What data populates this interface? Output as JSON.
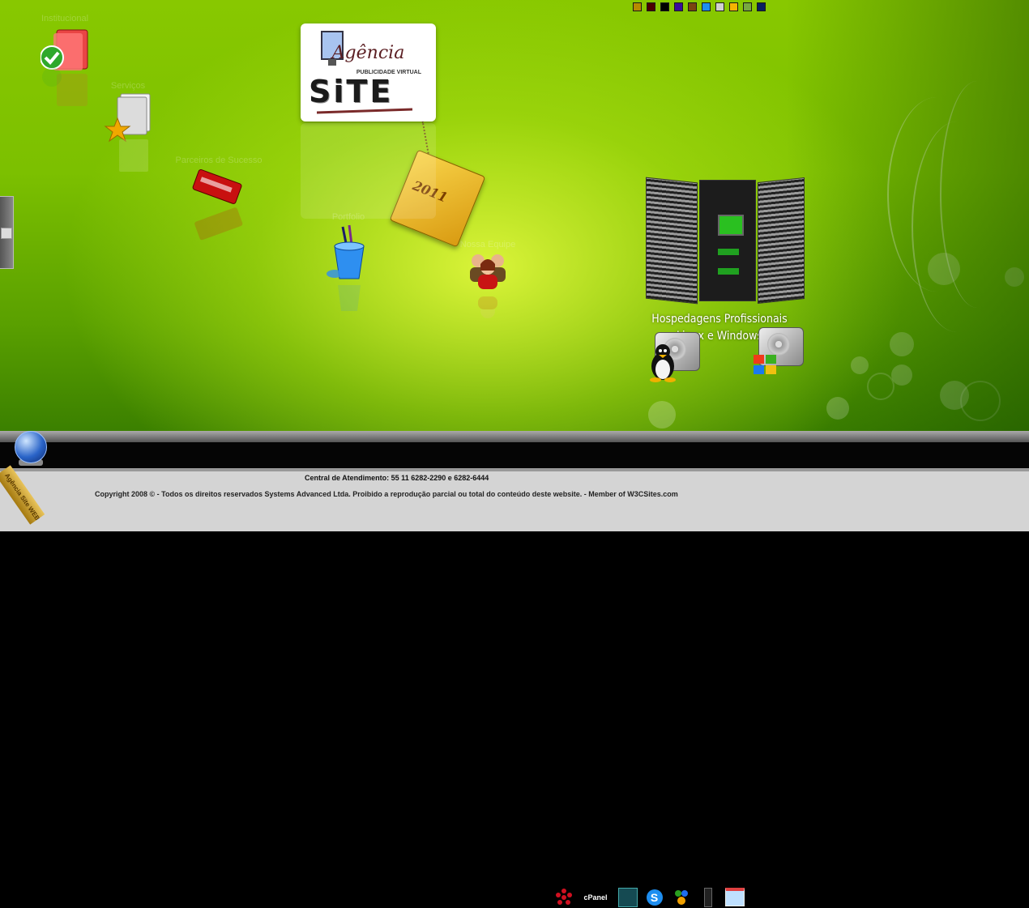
{
  "swatches": [
    "#b78a00",
    "#4a0000",
    "#000000",
    "#3a0c9c",
    "#7a4410",
    "#1e8ef0",
    "#d0d0d0",
    "#f5b400",
    "#78a840",
    "#0a2060"
  ],
  "desktop": {
    "items": [
      {
        "label": "Institucional",
        "icon": "folder-check-icon"
      },
      {
        "label": "Serviços",
        "icon": "document-star-icon"
      },
      {
        "label": "Parceiros de Sucesso",
        "icon": "red-card-icon"
      },
      {
        "label": "Portfolio",
        "icon": "paint-cup-icon"
      },
      {
        "label": "Nossa Equipe",
        "icon": "team-icon"
      }
    ]
  },
  "logo": {
    "script": "Agência",
    "subtitle": "PUBLICIDADE VIRTUAL",
    "big": "SiTE"
  },
  "tag": {
    "text": "2011"
  },
  "hosting": {
    "line1": "Hospedagens Profissionais",
    "line2": "Linux e Windows"
  },
  "taskbar": {
    "tray_icons": [
      "flower-icon",
      "cpanel-icon",
      "terminal-icon",
      "skype-icon",
      "msn-icon",
      "traffic-light-icon",
      "window-icon"
    ],
    "cpanel_label": "cPanel"
  },
  "footer": {
    "contact": "Central de Atendimento: 55 11 6282-2290 e 6282-6444",
    "copyright": "Copyright 2008 © - Todos os direitos reservados Systems Advanced Ltda. Proibido a reprodução parcial ou total do conteúdo deste website. - Member of W3CSites.com"
  },
  "seal": {
    "text": "Agência Site WEB 2.0"
  }
}
